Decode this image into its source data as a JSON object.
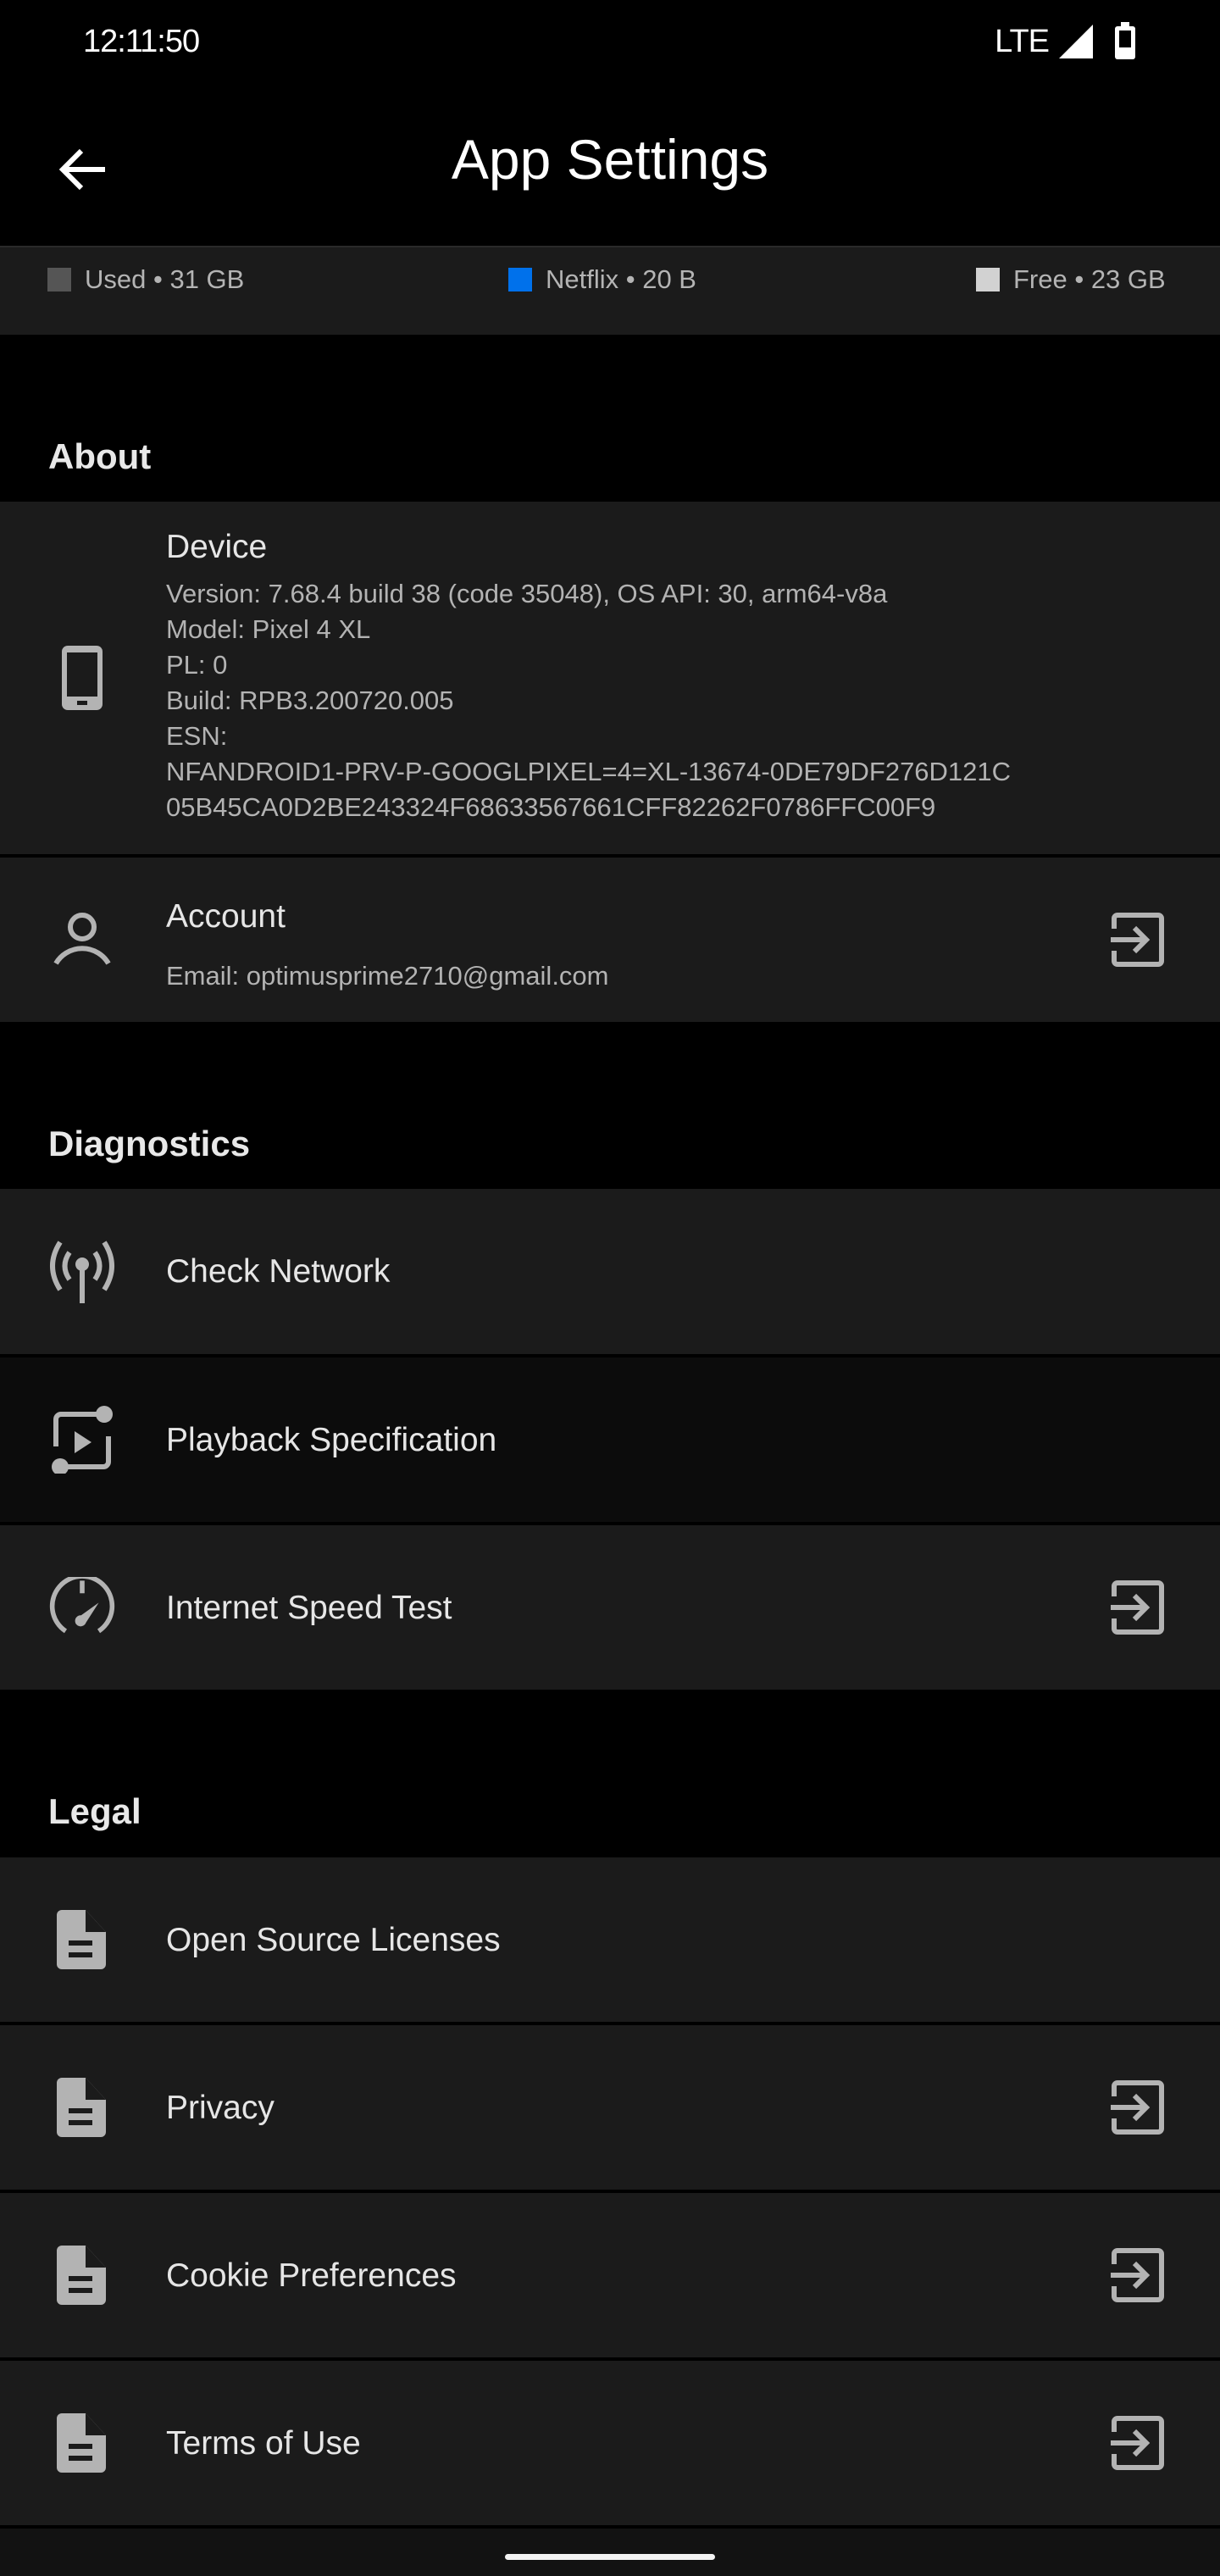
{
  "status_bar": {
    "time": "12:11:50",
    "network": "LTE",
    "icons": [
      "signal-icon",
      "battery-icon"
    ]
  },
  "header": {
    "title": "App Settings",
    "back_icon": "arrow-left-icon"
  },
  "storage": {
    "legend": [
      {
        "label": "Used • 31 GB",
        "color": "#555555"
      },
      {
        "label": "Netflix • 20 B",
        "color": "#0071eb"
      },
      {
        "label": "Free • 23 GB",
        "color": "#d2d2d2"
      }
    ]
  },
  "sections": {
    "about": {
      "title": "About",
      "device": {
        "title": "Device",
        "icon": "smartphone-icon",
        "lines": [
          "Version: 7.68.4 build 38 (code 35048), OS API: 30, arm64-v8a",
          "Model: Pixel 4 XL",
          "PL: 0",
          "Build: RPB3.200720.005",
          "ESN:",
          "NFANDROID1-PRV-P-GOOGLPIXEL=4=XL-13674-0DE79DF276D121C",
          "05B45CA0D2BE243324F68633567661CFF82262F0786FFC00F9"
        ]
      },
      "account": {
        "title": "Account",
        "icon": "person-icon",
        "email": "Email: optimusprime2710@gmail.com",
        "trailing_icon": "open-external-icon"
      }
    },
    "diagnostics": {
      "title": "Diagnostics",
      "items": [
        {
          "label": "Check Network",
          "icon": "antenna-icon"
        },
        {
          "label": "Playback Specification",
          "icon": "playback-spec-icon"
        },
        {
          "label": "Internet Speed Test",
          "icon": "speedometer-icon",
          "trailing_icon": "open-external-icon"
        }
      ]
    },
    "legal": {
      "title": "Legal",
      "items": [
        {
          "label": "Open Source Licenses",
          "icon": "document-icon"
        },
        {
          "label": "Privacy",
          "icon": "document-icon",
          "trailing_icon": "open-external-icon"
        },
        {
          "label": "Cookie Preferences",
          "icon": "document-icon",
          "trailing_icon": "open-external-icon"
        },
        {
          "label": "Terms of Use",
          "icon": "document-icon",
          "trailing_icon": "open-external-icon"
        }
      ]
    }
  }
}
